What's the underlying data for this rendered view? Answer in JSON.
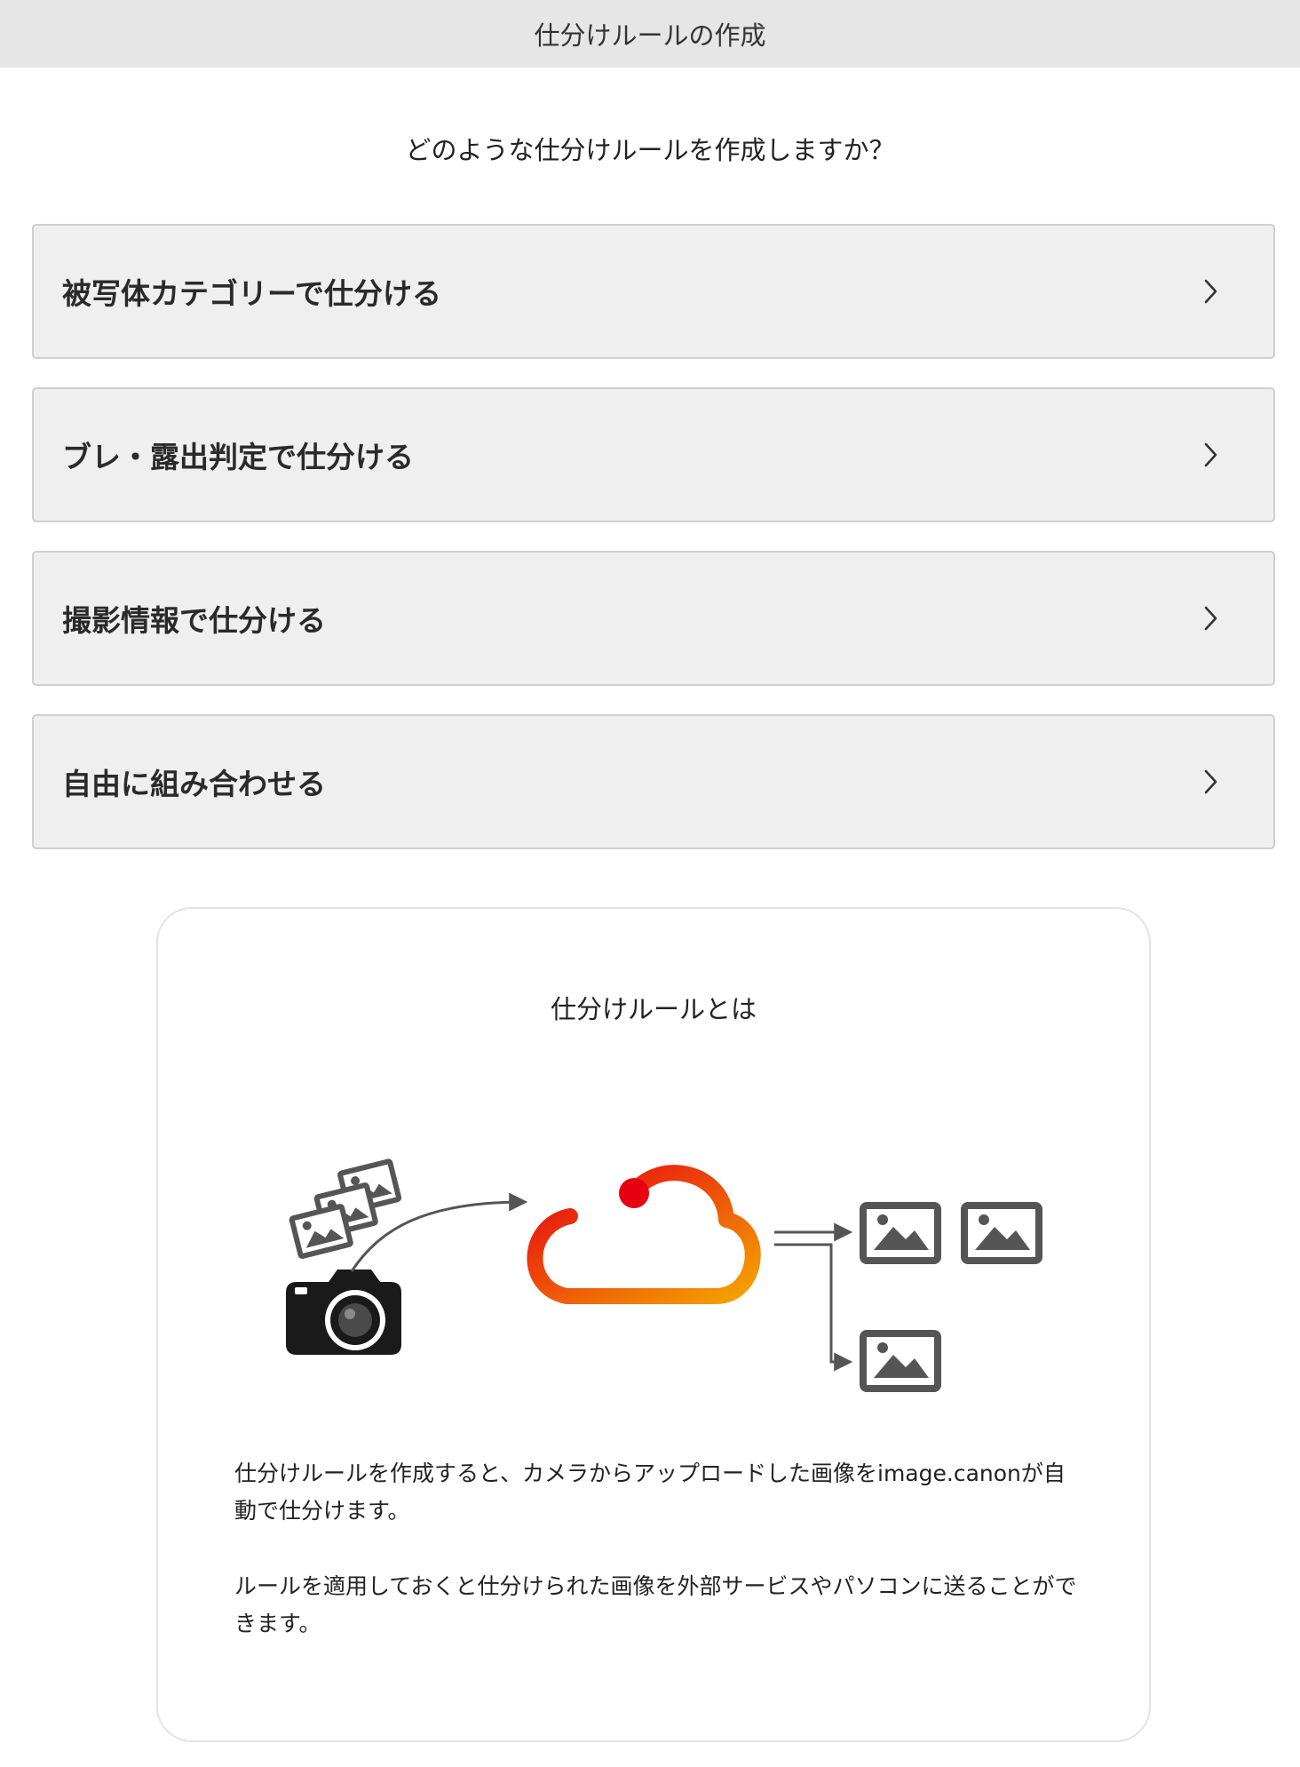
{
  "header": {
    "title": "仕分けルールの作成"
  },
  "question": "どのような仕分けルールを作成しますか？",
  "options": [
    {
      "label": "被写体カテゴリーで仕分ける",
      "icon": "chevron-right-icon"
    },
    {
      "label": "ブレ・露出判定で仕分ける",
      "icon": "chevron-right-icon"
    },
    {
      "label": "撮影情報で仕分ける",
      "icon": "chevron-right-icon"
    },
    {
      "label": "自由に組み合わせる",
      "icon": "chevron-right-icon"
    }
  ],
  "info": {
    "title": "仕分けルールとは",
    "paragraph1": "仕分けルールを作成すると、カメラからアップロードした画像をimage.canonが自動で仕分けます。",
    "paragraph2": "ルールを適用しておくと仕分けられた画像を外部サービスやパソコンに送ることができます。"
  },
  "colors": {
    "header_bg": "#e6e6e6",
    "option_bg": "#efefef",
    "cloud_start": "#e60012",
    "cloud_end": "#f5a400",
    "icon_dark": "#555555"
  }
}
